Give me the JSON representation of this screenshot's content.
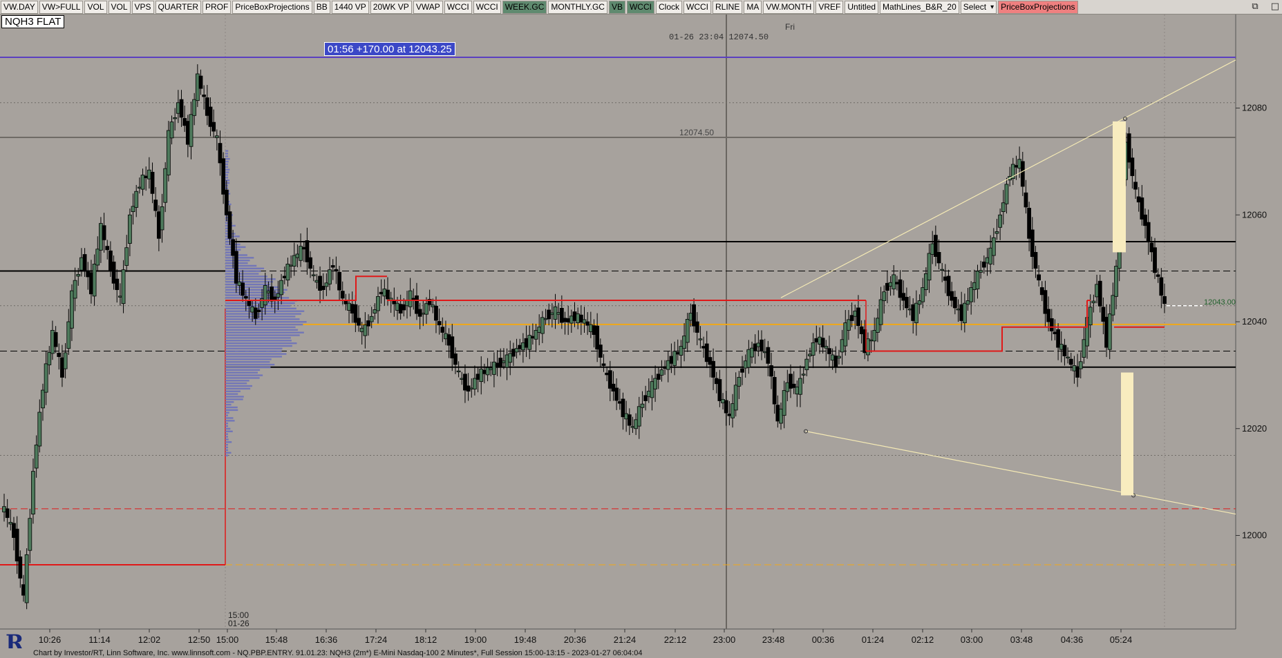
{
  "toolbar": {
    "buttons": [
      {
        "label": "VW.DAY",
        "state": "normal"
      },
      {
        "label": "VW>FULL",
        "state": "normal"
      },
      {
        "label": "VOL",
        "state": "normal"
      },
      {
        "label": "VOL",
        "state": "normal"
      },
      {
        "label": "VPS",
        "state": "normal"
      },
      {
        "label": "QUARTER",
        "state": "normal"
      },
      {
        "label": "PROF",
        "state": "normal"
      },
      {
        "label": "PriceBoxProjections",
        "state": "normal"
      },
      {
        "label": "BB",
        "state": "normal"
      },
      {
        "label": "1440 VP",
        "state": "normal"
      },
      {
        "label": "20WK VP",
        "state": "normal"
      },
      {
        "label": "VWAP",
        "state": "normal"
      },
      {
        "label": "WCCI",
        "state": "normal"
      },
      {
        "label": "WCCI",
        "state": "normal"
      },
      {
        "label": "WEEK.GC",
        "state": "green"
      },
      {
        "label": "MONTHLY.GC",
        "state": "normal"
      },
      {
        "label": "VB",
        "state": "green"
      },
      {
        "label": "WCCI",
        "state": "green"
      },
      {
        "label": "Clock",
        "state": "normal"
      },
      {
        "label": "WCCI",
        "state": "normal"
      },
      {
        "label": "RLINE",
        "state": "normal"
      },
      {
        "label": "MA",
        "state": "normal"
      },
      {
        "label": "VW.MONTH",
        "state": "normal"
      },
      {
        "label": "VREF",
        "state": "normal"
      },
      {
        "label": "Untitled",
        "state": "normal"
      },
      {
        "label": "MathLines_B&R_20",
        "state": "normal"
      },
      {
        "label": "Select",
        "state": "dropdown"
      },
      {
        "label": "PriceBoxProjections",
        "state": "red"
      }
    ],
    "window_controls": [
      "restore-icon",
      "maximize-icon"
    ]
  },
  "symbol_label": "NQH3 FLAT",
  "annotation": {
    "text": "01:56  +170.00 at 12043.25"
  },
  "crosshair_readout": {
    "datetime": "01-26 23:04",
    "price": "12074.50",
    "day": "Fri"
  },
  "level_label": "12074.50",
  "last_price_label": "12043.00",
  "session_marker": {
    "time": "15:00",
    "date": "01-26"
  },
  "status_text": "Chart by Investor/RT, Linn Software, Inc. www.linnsoft.com - NQ.PBP.ENTRY.   91.01.23: NQH3 (2m*) E-Mini Nasdaq-100 2 Minutes*, Full Session 15:00-13:15 - 2023-01-27 06:04:04",
  "colors": {
    "background": "#a7a29d",
    "bull_candle": "#4e7a5c",
    "bear_candle": "#000000",
    "profile": "#6f74b8",
    "red_level": "#e01818",
    "orange_level": "#f0a818",
    "purple_level": "#5a3fc0",
    "projection_line": "#f5eab5",
    "projection_box": "#f8ecbf"
  },
  "chart_data": {
    "type": "candlestick",
    "instrument": "NQH3",
    "interval": "2 Minutes",
    "y_axis_ticks": [
      12080,
      12060,
      12040,
      12020,
      12000
    ],
    "ylim": [
      11980,
      12094
    ],
    "x_axis_ticks": [
      "10:26",
      "11:14",
      "12:02",
      "12:50",
      "15:00",
      "15:48",
      "16:36",
      "17:24",
      "18:12",
      "19:00",
      "19:48",
      "20:36",
      "21:24",
      "22:12",
      "23:00",
      "23:48",
      "00:36",
      "01:24",
      "02:12",
      "03:00",
      "03:48",
      "04:36",
      "05:24"
    ],
    "horizontal_levels": [
      {
        "price": 12089.5,
        "style": "solid",
        "color": "purple"
      },
      {
        "price": 12074.5,
        "style": "solid",
        "color": "gray"
      },
      {
        "price": 12081.0,
        "style": "dotted",
        "color": "gray"
      },
      {
        "price": 12055.0,
        "style": "solid",
        "color": "black"
      },
      {
        "price": 12049.5,
        "style": "dashed",
        "color": "black"
      },
      {
        "price": 12043.0,
        "style": "dotted",
        "color": "gray"
      },
      {
        "price": 12039.5,
        "style": "solid",
        "color": "orange"
      },
      {
        "price": 12034.5,
        "style": "dashed",
        "color": "black"
      },
      {
        "price": 12031.5,
        "style": "solid",
        "color": "black"
      },
      {
        "price": 12015.0,
        "style": "dotted",
        "color": "gray"
      },
      {
        "price": 12005.0,
        "style": "dashed",
        "color": "red"
      },
      {
        "price": 11994.5,
        "style": "dashed",
        "color": "orange"
      }
    ],
    "price_path": [
      [
        0,
        12005
      ],
      [
        1,
        12000
      ],
      [
        2,
        11988
      ],
      [
        3,
        12012
      ],
      [
        4,
        12028
      ],
      [
        5,
        12038
      ],
      [
        6,
        12030
      ],
      [
        7,
        12045
      ],
      [
        8,
        12052
      ],
      [
        9,
        12046
      ],
      [
        10,
        12058
      ],
      [
        11,
        12050
      ],
      [
        12,
        12044
      ],
      [
        13,
        12060
      ],
      [
        14,
        12066
      ],
      [
        15,
        12068
      ],
      [
        16,
        12056
      ],
      [
        17,
        12075
      ],
      [
        18,
        12081
      ],
      [
        19,
        12074
      ],
      [
        20,
        12086
      ],
      [
        21,
        12079
      ],
      [
        22,
        12074
      ],
      [
        23,
        12060
      ],
      [
        24,
        12048
      ],
      [
        25,
        12044
      ],
      [
        26,
        12041
      ],
      [
        27,
        12046
      ],
      [
        28,
        12044
      ],
      [
        29,
        12049
      ],
      [
        30,
        12052
      ],
      [
        31,
        12054
      ],
      [
        32,
        12048
      ],
      [
        33,
        12046
      ],
      [
        34,
        12051
      ],
      [
        35,
        12044
      ],
      [
        36,
        12042
      ],
      [
        37,
        12038
      ],
      [
        38,
        12041
      ],
      [
        39,
        12046
      ],
      [
        40,
        12044
      ],
      [
        41,
        12042
      ],
      [
        42,
        12045
      ],
      [
        43,
        12041
      ],
      [
        44,
        12044
      ],
      [
        45,
        12039
      ],
      [
        46,
        12036
      ],
      [
        47,
        12030
      ],
      [
        48,
        12027
      ],
      [
        49,
        12030
      ],
      [
        50,
        12031
      ],
      [
        51,
        12032
      ],
      [
        52,
        12033
      ],
      [
        53,
        12035
      ],
      [
        54,
        12036
      ],
      [
        55,
        12038
      ],
      [
        56,
        12041
      ],
      [
        57,
        12042
      ],
      [
        58,
        12040
      ],
      [
        59,
        12041
      ],
      [
        60,
        12040
      ],
      [
        61,
        12038
      ],
      [
        62,
        12031
      ],
      [
        63,
        12027
      ],
      [
        64,
        12023
      ],
      [
        65,
        12020
      ],
      [
        66,
        12025
      ],
      [
        67,
        12028
      ],
      [
        68,
        12031
      ],
      [
        69,
        12033
      ],
      [
        70,
        12035
      ],
      [
        71,
        12042
      ],
      [
        72,
        12036
      ],
      [
        73,
        12032
      ],
      [
        74,
        12026
      ],
      [
        75,
        12022
      ],
      [
        76,
        12030
      ],
      [
        77,
        12034
      ],
      [
        78,
        12036
      ],
      [
        79,
        12033
      ],
      [
        80,
        12021
      ],
      [
        81,
        12029
      ],
      [
        82,
        12027
      ],
      [
        83,
        12033
      ],
      [
        84,
        12037
      ],
      [
        85,
        12035
      ],
      [
        86,
        12032
      ],
      [
        87,
        12039
      ],
      [
        88,
        12042
      ],
      [
        89,
        12035
      ],
      [
        90,
        12038
      ],
      [
        91,
        12046
      ],
      [
        92,
        12048
      ],
      [
        93,
        12044
      ],
      [
        94,
        12041
      ],
      [
        95,
        12046
      ],
      [
        96,
        12055
      ],
      [
        97,
        12049
      ],
      [
        98,
        12044
      ],
      [
        99,
        12041
      ],
      [
        100,
        12046
      ],
      [
        101,
        12050
      ],
      [
        102,
        12053
      ],
      [
        103,
        12060
      ],
      [
        104,
        12068
      ],
      [
        105,
        12070
      ],
      [
        106,
        12056
      ],
      [
        107,
        12047
      ],
      [
        108,
        12040
      ],
      [
        109,
        12036
      ],
      [
        110,
        12033
      ],
      [
        111,
        12030
      ],
      [
        112,
        12040
      ],
      [
        113,
        12047
      ],
      [
        114,
        12036
      ],
      [
        115,
        12050
      ],
      [
        116,
        12074
      ],
      [
        117,
        12064
      ],
      [
        118,
        12058
      ],
      [
        119,
        12050
      ],
      [
        120,
        12043
      ]
    ],
    "projection_wedge": {
      "upper_from": 12044.5,
      "upper_to": 12089,
      "lower_from": 12019.5,
      "lower_to": 12004
    },
    "projection_box_top": {
      "from": 12077.5,
      "to": 12053
    },
    "projection_box_bottom": {
      "from": 12030.5,
      "to": 12007.5
    },
    "red_box_levels": [
      12048.5,
      12044.0,
      12039.0,
      12034.5
    ]
  }
}
